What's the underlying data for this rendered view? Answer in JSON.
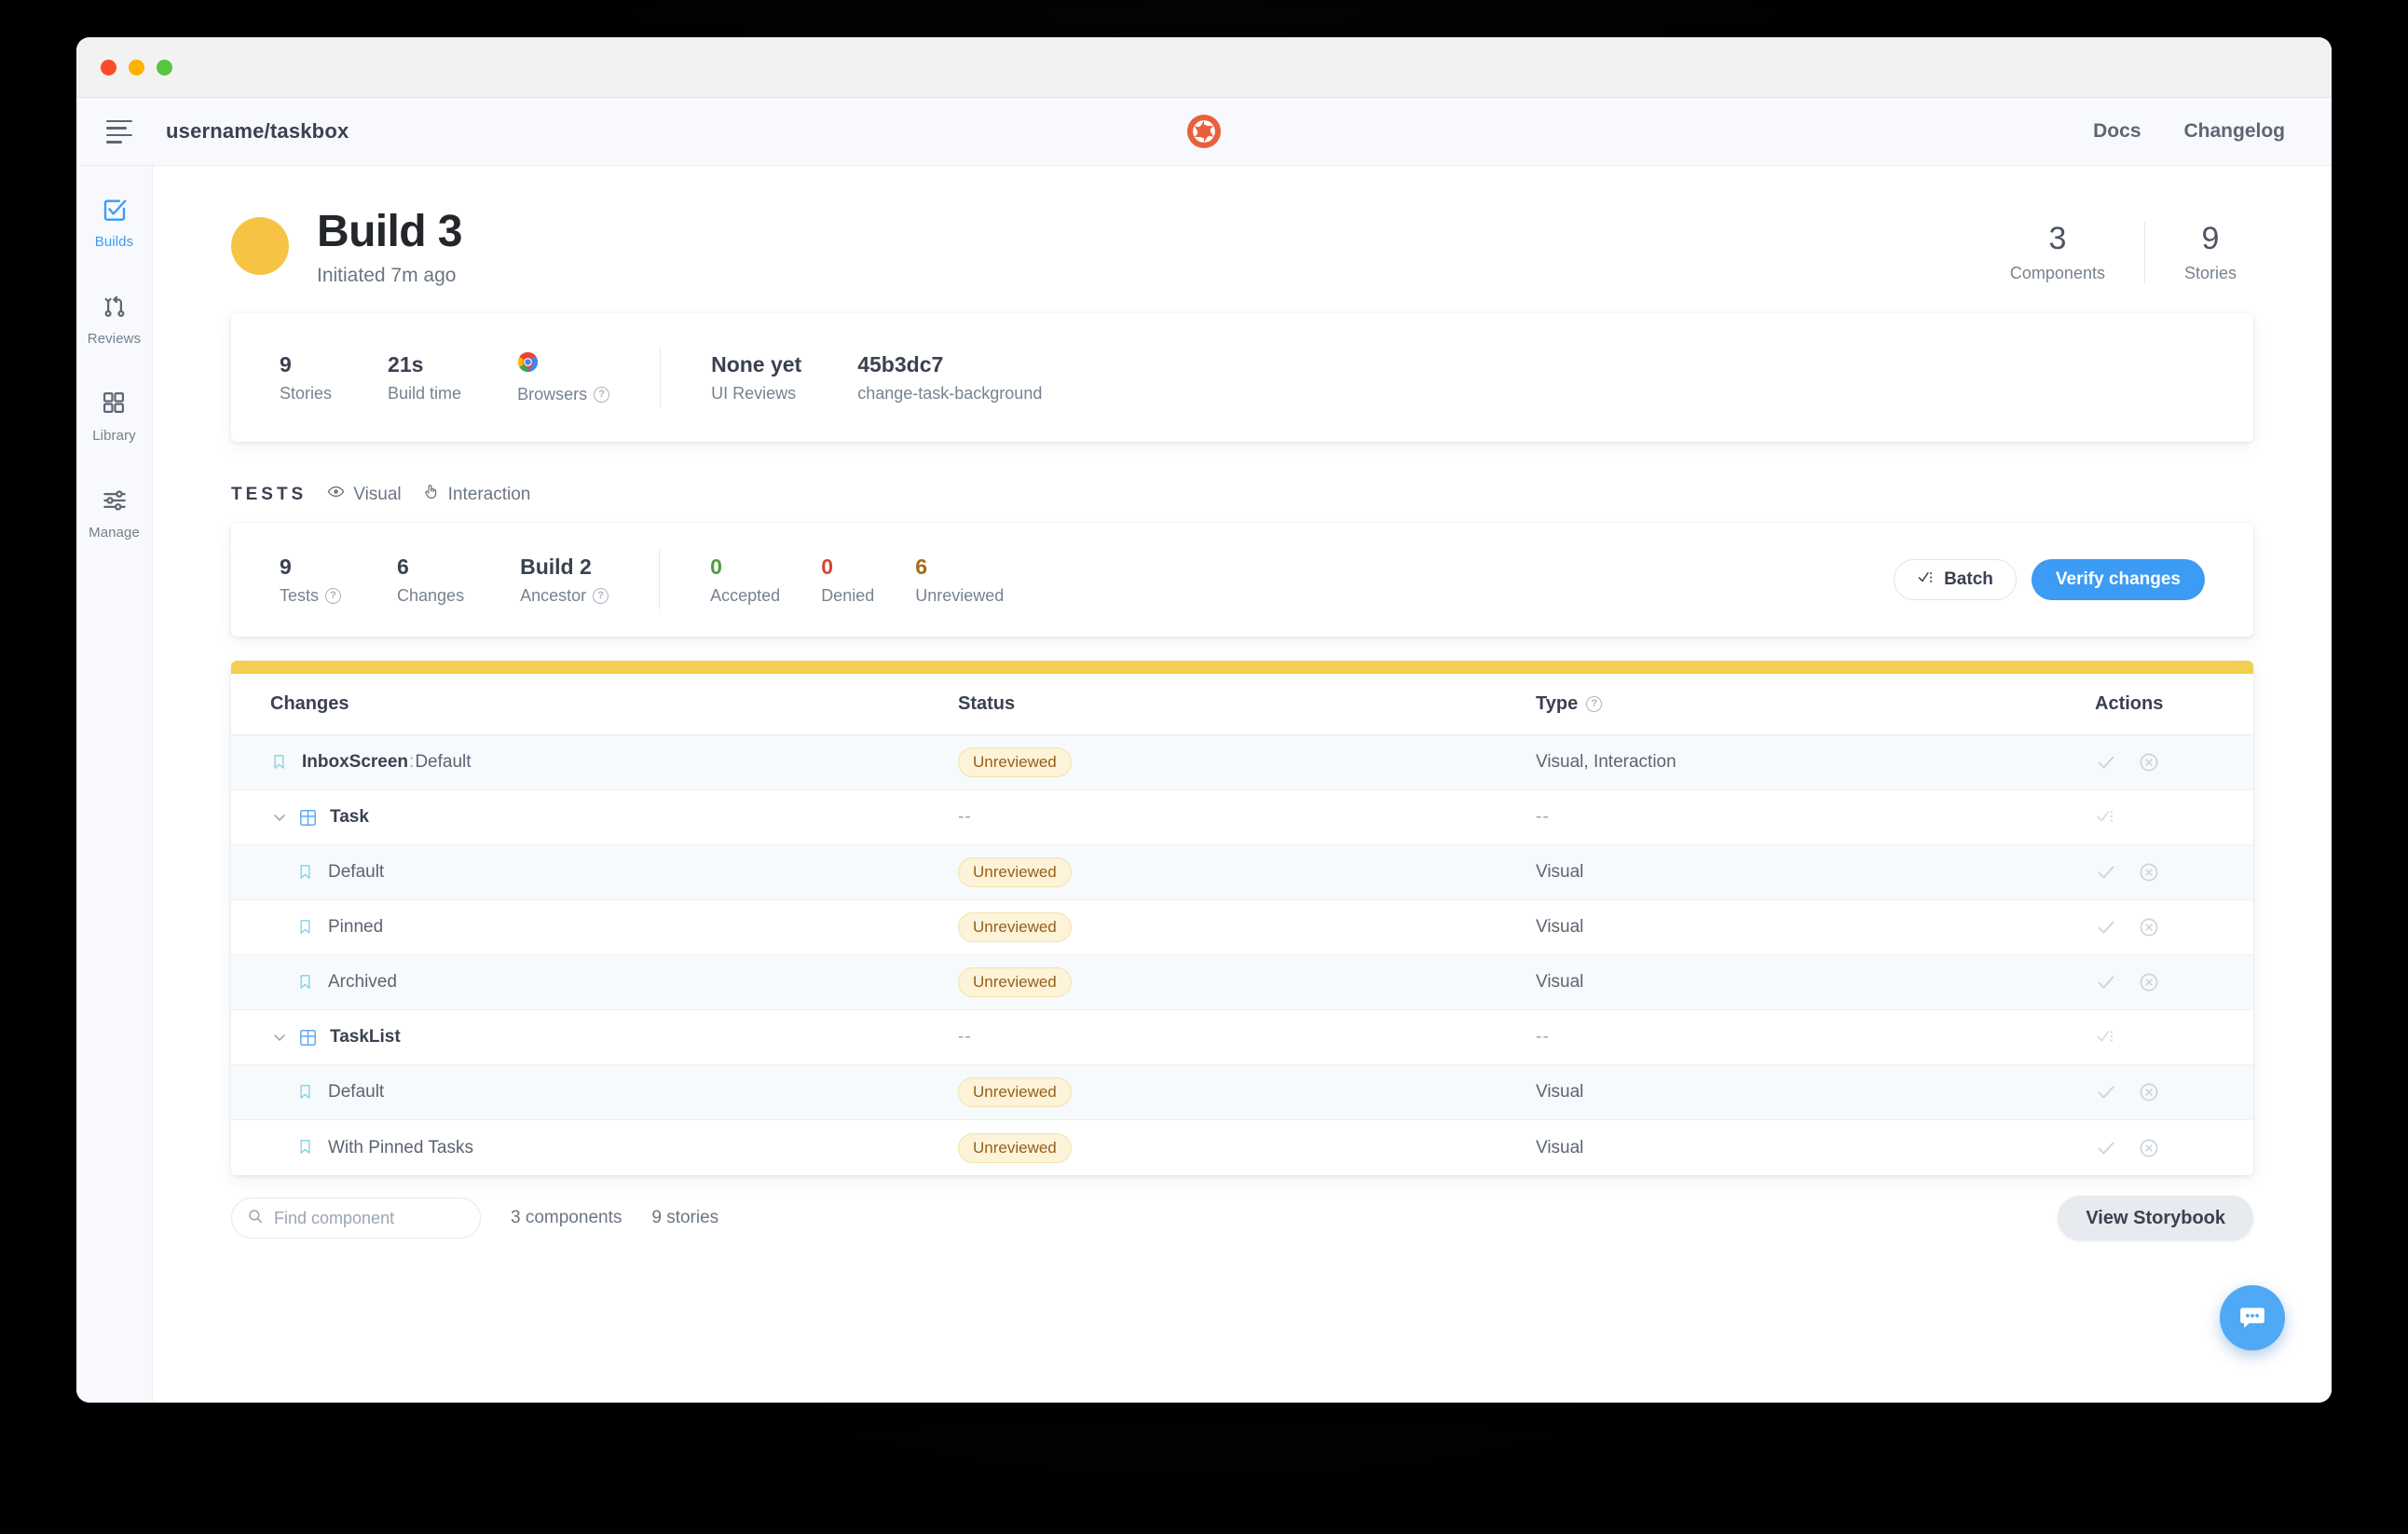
{
  "window": {
    "traffic_lights": [
      "close",
      "minimize",
      "maximize"
    ]
  },
  "header": {
    "repo": "username/taskbox",
    "logo_icon": "chromatic-logo-icon",
    "menu_icon": "hamburger-menu-icon",
    "links": [
      {
        "label": "Docs"
      },
      {
        "label": "Changelog"
      }
    ]
  },
  "sidebar": {
    "items": [
      {
        "label": "Builds",
        "icon": "checkbox-check-icon",
        "active": true
      },
      {
        "label": "Reviews",
        "icon": "pull-request-icon",
        "active": false
      },
      {
        "label": "Library",
        "icon": "grid-squares-icon",
        "active": false
      },
      {
        "label": "Manage",
        "icon": "sliders-icon",
        "active": false
      }
    ]
  },
  "hero": {
    "title": "Build 3",
    "subtitle": "Initiated 7m ago",
    "avatar_color": "#F6C344",
    "stats": [
      {
        "value": "3",
        "label": "Components"
      },
      {
        "value": "9",
        "label": "Stories"
      }
    ]
  },
  "summary": {
    "stories": {
      "value": "9",
      "label": "Stories"
    },
    "build_time": {
      "value": "21s",
      "label": "Build time"
    },
    "browsers": {
      "label": "Browsers",
      "icon": "chrome-icon",
      "help": "?"
    },
    "ui_reviews": {
      "value": "None yet",
      "label": "UI Reviews"
    },
    "commit": {
      "value": "45b3dc7",
      "label": "change-task-background",
      "color": "#3B9BF5"
    }
  },
  "tests_section": {
    "heading": "TESTS",
    "chips": [
      {
        "label": "Visual",
        "icon": "eye-icon"
      },
      {
        "label": "Interaction",
        "icon": "pointer-hand-icon"
      }
    ],
    "stats": [
      {
        "value": "9",
        "label": "Tests",
        "help": "?",
        "color": "#3A4150"
      },
      {
        "value": "6",
        "label": "Changes",
        "color": "#3A4150"
      },
      {
        "value": "Build 2",
        "label": "Ancestor",
        "help": "?",
        "color": "#3B9BF5"
      },
      {
        "value": "0",
        "label": "Accepted",
        "color": "#4D9D3F"
      },
      {
        "value": "0",
        "label": "Denied",
        "color": "#D6452F"
      },
      {
        "value": "6",
        "label": "Unreviewed",
        "color": "#A86A16"
      }
    ],
    "batch_button": {
      "label": "Batch",
      "icon": "batch-check-icon"
    },
    "verify_button": {
      "label": "Verify changes",
      "color": "#3B9BF5"
    }
  },
  "table": {
    "stripe_color": "#F2CF4E",
    "columns": [
      {
        "label": "Changes"
      },
      {
        "label": "Status"
      },
      {
        "label": "Type",
        "help": "?"
      },
      {
        "label": "Actions"
      }
    ],
    "rows": [
      {
        "kind": "story",
        "indent": 1,
        "icon": "bookmark-icon",
        "name": "InboxScreen",
        "separator": ":",
        "variant": "Default",
        "status": "Unreviewed",
        "type": "Visual, Interaction",
        "actions": [
          "accept-check-icon",
          "deny-circle-x-icon"
        ],
        "alt": true
      },
      {
        "kind": "component",
        "indent": 1,
        "icon": "component-grid-icon",
        "chevron": "chevron-down-icon",
        "name": "Task",
        "separator": "",
        "variant": "",
        "status": "--",
        "type": "--",
        "actions": [
          "batch-check-icon"
        ],
        "alt": false
      },
      {
        "kind": "story",
        "indent": 2,
        "icon": "bookmark-icon",
        "name": "",
        "separator": "",
        "variant": "Default",
        "status": "Unreviewed",
        "type": "Visual",
        "actions": [
          "accept-check-icon",
          "deny-circle-x-icon"
        ],
        "alt": true
      },
      {
        "kind": "story",
        "indent": 2,
        "icon": "bookmark-icon",
        "name": "",
        "separator": "",
        "variant": "Pinned",
        "status": "Unreviewed",
        "type": "Visual",
        "actions": [
          "accept-check-icon",
          "deny-circle-x-icon"
        ],
        "alt": false
      },
      {
        "kind": "story",
        "indent": 2,
        "icon": "bookmark-icon",
        "name": "",
        "separator": "",
        "variant": "Archived",
        "status": "Unreviewed",
        "type": "Visual",
        "actions": [
          "accept-check-icon",
          "deny-circle-x-icon"
        ],
        "alt": true
      },
      {
        "kind": "component",
        "indent": 1,
        "icon": "component-grid-icon",
        "chevron": "chevron-down-icon",
        "name": "TaskList",
        "separator": "",
        "variant": "",
        "status": "--",
        "type": "--",
        "actions": [
          "batch-check-icon"
        ],
        "alt": false
      },
      {
        "kind": "story",
        "indent": 2,
        "icon": "bookmark-icon",
        "name": "",
        "separator": "",
        "variant": "Default",
        "status": "Unreviewed",
        "type": "Visual",
        "actions": [
          "accept-check-icon",
          "deny-circle-x-icon"
        ],
        "alt": true
      },
      {
        "kind": "story",
        "indent": 2,
        "icon": "bookmark-icon",
        "name": "",
        "separator": "",
        "variant": "With Pinned Tasks",
        "status": "Unreviewed",
        "type": "Visual",
        "actions": [
          "accept-check-icon",
          "deny-circle-x-icon"
        ],
        "alt": false
      }
    ]
  },
  "footer": {
    "search_placeholder": "Find component",
    "search_value": "",
    "search_icon": "search-icon",
    "components_count": "3 components",
    "stories_count": "9 stories",
    "view_storybook": "View Storybook",
    "chat_icon": "chat-bubble-icon"
  }
}
